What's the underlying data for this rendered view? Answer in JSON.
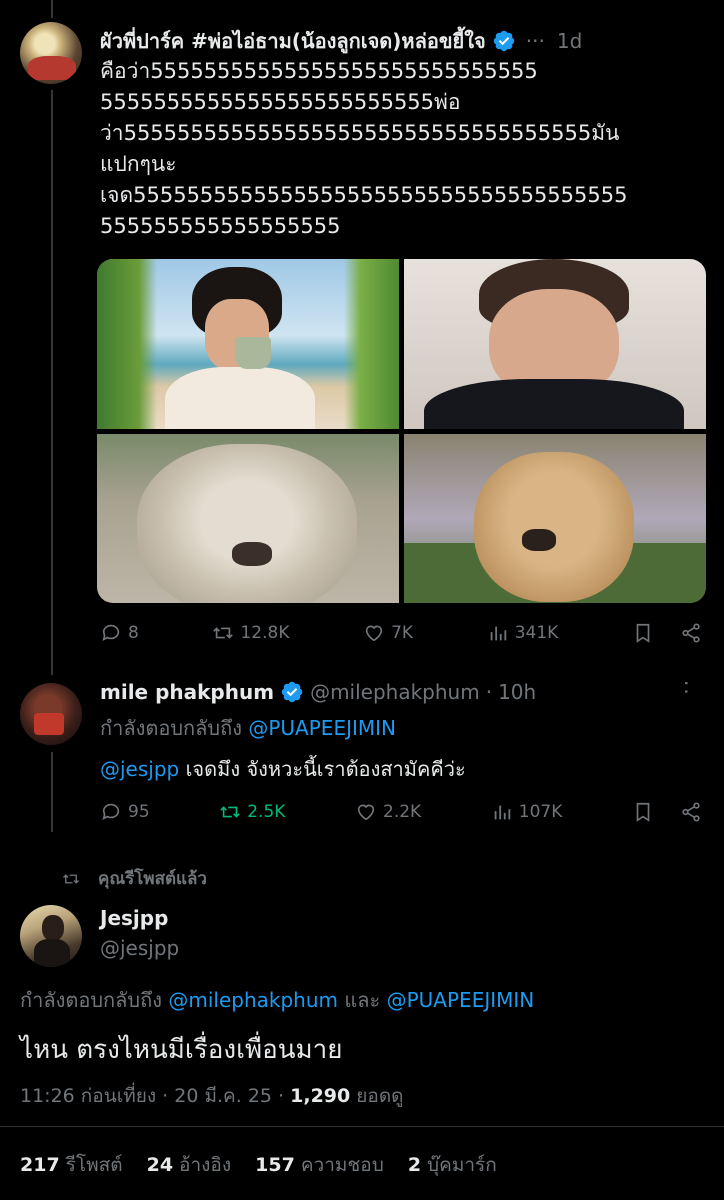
{
  "tweet1": {
    "display_name": "ผัวพี่ปาร์ค #พ่อไอ่ธาม(น้องลูกเจด)หล่อขยี้ใจ",
    "more": "···",
    "time": "1d",
    "text_lines": [
      "คือว่า55555555555555555555555555555",
      "5555555555555555555555555พ่อ",
      "ว่า55555555555555555555555555555555555มัน",
      "แปกๆนะ",
      "เจด5555555555555555555555555555555555555",
      "555555555555555555"
    ],
    "images": [
      "man-drinking-coffee-beach",
      "man-puffed-cheeks",
      "lion-face",
      "puppy-face"
    ],
    "actions": {
      "replies": "8",
      "reposts": "12.8K",
      "likes": "7K",
      "views": "341K"
    }
  },
  "tweet2": {
    "display_name": "mile phakphum",
    "handle": "@milephakphum",
    "dot": "·",
    "time": "10h",
    "more": "··",
    "replying_prefix": "กำลังตอบกลับถึง",
    "replying_to": "@PUAPEEJIMIN",
    "mention": "@jesjpp",
    "text": "เจดมึง จังหวะนี้เราต้องสามัคคีว่ะ",
    "actions": {
      "replies": "95",
      "reposts": "2.5K",
      "likes": "2.2K",
      "views": "107K"
    }
  },
  "repost_label": "คุณรีโพสต์แล้ว",
  "main": {
    "display_name": "Jesjpp",
    "handle": "@jesjpp",
    "replying_prefix": "กำลังตอบกลับถึง",
    "replying_to_1": "@milephakphum",
    "and": "และ",
    "replying_to_2": "@PUAPEEJIMIN",
    "text": "ไหน ตรงไหนมีเรื่องเพื่อนมาย",
    "time_date": "11:26 ก่อนเที่ยง · 20 มี.ค. 25 ·",
    "view_count": "1,290",
    "view_label": "ยอดดู",
    "stats": [
      {
        "count": "217",
        "label": "รีโพสต์"
      },
      {
        "count": "24",
        "label": "อ้างอิง"
      },
      {
        "count": "157",
        "label": "ความชอบ"
      },
      {
        "count": "2",
        "label": "บุ๊คมาร์ก"
      }
    ]
  },
  "colors": {
    "accent": "#1d9bf0",
    "repost_green": "#00ba7c",
    "muted": "#71767b"
  }
}
